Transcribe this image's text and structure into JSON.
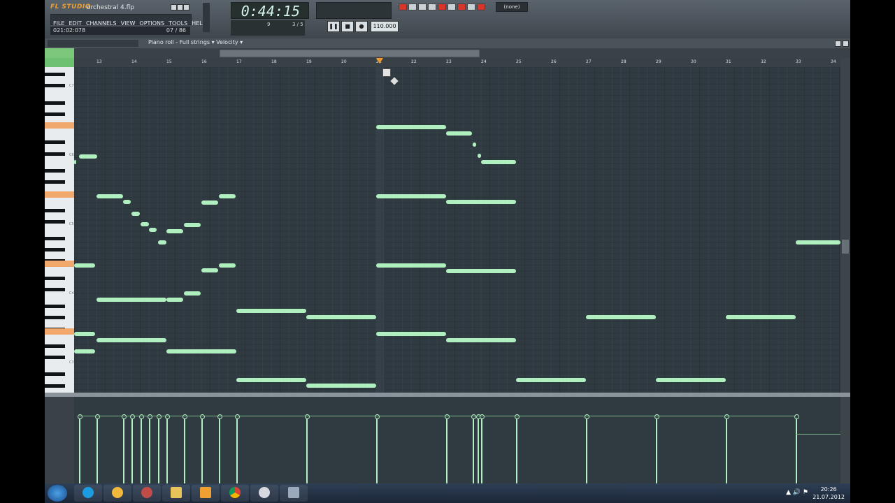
{
  "app": {
    "logo": "FL STUDIO",
    "song_title": "orchestral 4.flp",
    "menu": [
      "FILE",
      "EDIT",
      "CHANNELS",
      "VIEW",
      "OPTIONS",
      "TOOLS",
      "HELP"
    ],
    "hint_left": "021:02:078",
    "hint_right": "07 / 86",
    "time": "0:44:15",
    "pattern_selector": "(none)",
    "tempo": "110.000",
    "pattern_num": "9",
    "step_value": "3 / 5"
  },
  "piano_roll": {
    "title": "Piano roll - Full strings",
    "target": "Velocity",
    "ruler_ticks": [
      "13",
      "14",
      "15",
      "16",
      "17",
      "18",
      "19",
      "20",
      "21",
      "22",
      "23",
      "24",
      "25",
      "26",
      "27",
      "28",
      "29",
      "30",
      "31",
      "32",
      "33",
      "34"
    ],
    "key_labels": [
      "C7",
      "C6",
      "C5",
      "C4",
      "C3"
    ]
  },
  "taskbar": {
    "clock_time": "20:26",
    "clock_date": "21.07.2012",
    "apps": [
      "skype-icon",
      "fl-studio-icon",
      "wine-icon",
      "explorer-icon",
      "media-icon",
      "chrome-icon",
      "app-icon",
      "window-icon"
    ]
  },
  "colors": {
    "note": "#b0f0c0",
    "grid_bg": "#303a41",
    "accent": "#f09a2a"
  }
}
